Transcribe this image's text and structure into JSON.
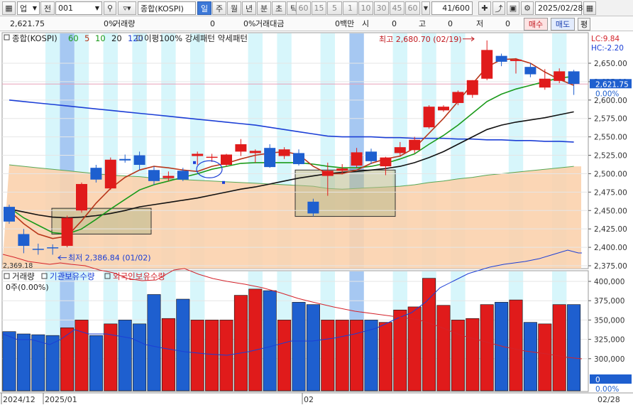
{
  "toolbar": {
    "market": "업",
    "prev_label": "전",
    "code": "001",
    "index_name": "종합(KOSPI)",
    "periods": [
      {
        "label": "일",
        "active": true
      },
      {
        "label": "주",
        "active": false
      },
      {
        "label": "월",
        "active": false
      },
      {
        "label": "년",
        "active": false
      },
      {
        "label": "분",
        "active": false
      },
      {
        "label": "초",
        "active": false
      },
      {
        "label": "틱",
        "active": false
      }
    ],
    "intervals": [
      "60",
      "15",
      "5",
      "1",
      "10",
      "30",
      "45",
      "60"
    ],
    "count": "41",
    "count_total": "/600",
    "date": "2025/02/28"
  },
  "quote": {
    "price": "2,621.75",
    "pct": "0%",
    "volume_label": "거래량",
    "volume": "0",
    "pct2": "0%",
    "amount_label": "거래대금",
    "amount": "0백만",
    "open_label": "시",
    "open": "0",
    "high_label": "고",
    "high": "0",
    "low_label": "저",
    "low": "0",
    "buy_label": "매수",
    "sell_label": "매도",
    "eval_label": "평"
  },
  "price_panel": {
    "legend_name": "종합(KOSPI)",
    "ma_periods": [
      {
        "label": "60",
        "color": "#1a9a1a"
      },
      {
        "label": "5",
        "color": "#b8361a"
      },
      {
        "label": "10",
        "color": "#1a9a1a"
      },
      {
        "label": "20",
        "color": "#222222"
      },
      {
        "label": "120",
        "color": "#1c3fd6"
      }
    ],
    "legend_extra": "이평100% 강세패턴  약세패턴",
    "lc": "LC:9.84",
    "hc": "HC:-2.20",
    "current": "2,621.75",
    "current_pct": "0.00%",
    "high_annot": "최고 2,680.70 (02/19)",
    "low_annot": "최저 2,386.84 (01/02)",
    "clipped_label": "2,369.18",
    "yticks": [
      "2,650.00",
      "2,625.00",
      "2,600.00",
      "2,575.00",
      "2,550.00",
      "2,525.00",
      "2,500.00",
      "2,475.00",
      "2,450.00",
      "2,425.00",
      "2,400.00",
      "2,375.00"
    ]
  },
  "volume_panel": {
    "legend": [
      {
        "label": "거래량",
        "color": "#222222"
      },
      {
        "label": "기관보유수량",
        "color": "#1c3fd6"
      },
      {
        "label": "외국인보유수량",
        "color": "#d4232b"
      }
    ],
    "sub_label": "0주(0.00%)",
    "yticks": [
      "400,000",
      "375,000",
      "350,000",
      "325,000",
      "300,000"
    ],
    "current": "0",
    "current_pct": "0.00%"
  },
  "date_axis": {
    "labels": [
      "2024/12",
      "2025/01",
      "02"
    ],
    "current": "02/28"
  },
  "colors": {
    "up": "#e01b1b",
    "down": "#1e5fcf",
    "sky": "#d7f6fb",
    "sky_dark": "#a6c8f2",
    "cloud": "#fbd1ad"
  },
  "chart_data": {
    "type": "candlestick",
    "title": "종합(KOSPI)",
    "ohlc": [
      {
        "o": 2455,
        "h": 2458,
        "l": 2432,
        "c": 2435
      },
      {
        "o": 2418,
        "h": 2425,
        "l": 2392,
        "c": 2402
      },
      {
        "o": 2398,
        "h": 2405,
        "l": 2390,
        "c": 2397
      },
      {
        "o": 2400,
        "h": 2404,
        "l": 2390,
        "c": 2399
      },
      {
        "o": 2402,
        "h": 2443,
        "l": 2400,
        "c": 2440
      },
      {
        "o": 2450,
        "h": 2488,
        "l": 2447,
        "c": 2486
      },
      {
        "o": 2508,
        "h": 2512,
        "l": 2488,
        "c": 2492
      },
      {
        "o": 2480,
        "h": 2522,
        "l": 2478,
        "c": 2519
      },
      {
        "o": 2520,
        "h": 2526,
        "l": 2515,
        "c": 2518
      },
      {
        "o": 2525,
        "h": 2530,
        "l": 2505,
        "c": 2512
      },
      {
        "o": 2505,
        "h": 2510,
        "l": 2485,
        "c": 2490
      },
      {
        "o": 2494,
        "h": 2503,
        "l": 2490,
        "c": 2497
      },
      {
        "o": 2504,
        "h": 2508,
        "l": 2490,
        "c": 2492
      },
      {
        "o": 2524,
        "h": 2530,
        "l": 2512,
        "c": 2527
      },
      {
        "o": 2522,
        "h": 2527,
        "l": 2516,
        "c": 2523
      },
      {
        "o": 2512,
        "h": 2527,
        "l": 2510,
        "c": 2526
      },
      {
        "o": 2530,
        "h": 2547,
        "l": 2524,
        "c": 2540
      },
      {
        "o": 2528,
        "h": 2533,
        "l": 2515,
        "c": 2531
      },
      {
        "o": 2535,
        "h": 2540,
        "l": 2508,
        "c": 2509
      },
      {
        "o": 2524,
        "h": 2536,
        "l": 2520,
        "c": 2533
      },
      {
        "o": 2528,
        "h": 2533,
        "l": 2511,
        "c": 2513
      },
      {
        "o": 2462,
        "h": 2466,
        "l": 2442,
        "c": 2446
      },
      {
        "o": 2497,
        "h": 2515,
        "l": 2470,
        "c": 2504
      },
      {
        "o": 2504,
        "h": 2513,
        "l": 2499,
        "c": 2507
      },
      {
        "o": 2511,
        "h": 2535,
        "l": 2508,
        "c": 2529
      },
      {
        "o": 2530,
        "h": 2534,
        "l": 2513,
        "c": 2517
      },
      {
        "o": 2510,
        "h": 2523,
        "l": 2498,
        "c": 2522
      },
      {
        "o": 2528,
        "h": 2543,
        "l": 2523,
        "c": 2536
      },
      {
        "o": 2532,
        "h": 2550,
        "l": 2528,
        "c": 2546
      },
      {
        "o": 2563,
        "h": 2593,
        "l": 2561,
        "c": 2591
      },
      {
        "o": 2586,
        "h": 2593,
        "l": 2584,
        "c": 2591
      },
      {
        "o": 2596,
        "h": 2613,
        "l": 2593,
        "c": 2611
      },
      {
        "o": 2607,
        "h": 2627,
        "l": 2603,
        "c": 2627
      },
      {
        "o": 2629,
        "h": 2681,
        "l": 2627,
        "c": 2668
      },
      {
        "o": 2660,
        "h": 2663,
        "l": 2646,
        "c": 2652
      },
      {
        "o": 2653,
        "h": 2657,
        "l": 2636,
        "c": 2655
      },
      {
        "o": 2645,
        "h": 2650,
        "l": 2631,
        "c": 2635
      },
      {
        "o": 2617,
        "h": 2642,
        "l": 2614,
        "c": 2629
      },
      {
        "o": 2626,
        "h": 2643,
        "l": 2623,
        "c": 2639
      },
      {
        "o": 2639,
        "h": 2641,
        "l": 2607,
        "c": 2622
      }
    ],
    "volume_bars": [
      335000,
      332000,
      331000,
      330000,
      340000,
      350000,
      330000,
      345000,
      350000,
      345000,
      383000,
      352000,
      377000,
      350000,
      350000,
      350000,
      382000,
      390000,
      388000,
      350000,
      373000,
      370000,
      350000,
      350000,
      350000,
      350000,
      347000,
      363000,
      367000,
      404000,
      369000,
      350000,
      352000,
      370000,
      373000,
      376000,
      347000,
      345000,
      370000,
      370000
    ],
    "ylim": [
      2369.18,
      2690
    ],
    "volume_ylim": [
      285000,
      410000
    ]
  }
}
